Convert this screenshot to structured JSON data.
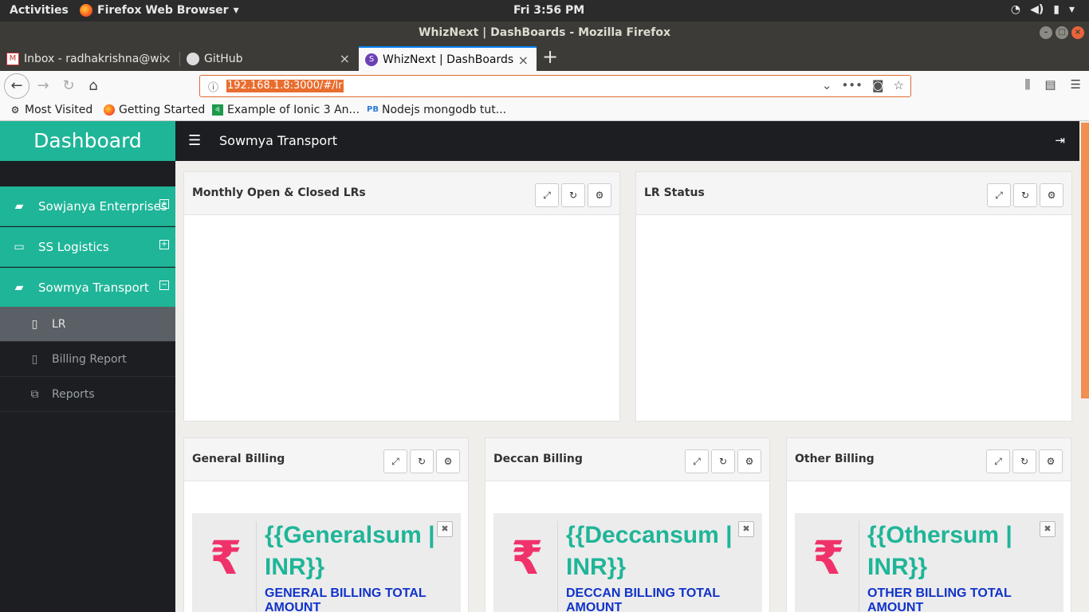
{
  "system": {
    "activities": "Activities",
    "app_menu": "Firefox Web Browser",
    "clock": "Fri  3:56 PM"
  },
  "window": {
    "title": "WhizNext | DashBoards - Mozilla Firefox"
  },
  "tabs": [
    {
      "label": "Inbox - radhakrishna@wi"
    },
    {
      "label": "GitHub"
    },
    {
      "label": "WhizNext | DashBoards"
    }
  ],
  "address_bar": {
    "url": "192.168.1.8:3000/#/lr"
  },
  "bookmarks": [
    {
      "label": "Most Visited"
    },
    {
      "label": "Getting Started"
    },
    {
      "label": "Example of Ionic 3 An..."
    },
    {
      "label": "Nodejs mongodb tut..."
    }
  ],
  "sidebar": {
    "brand": "Dashboard",
    "items": [
      {
        "label": "Sowjanya Enterprises"
      },
      {
        "label": "SS Logistics"
      },
      {
        "label": "Sowmya Transport"
      }
    ],
    "subitems": [
      {
        "label": "LR"
      },
      {
        "label": "Billing Report"
      },
      {
        "label": "Reports"
      }
    ]
  },
  "topbar": {
    "company": "Sowmya Transport"
  },
  "panels": {
    "monthly": {
      "title": "Monthly Open & Closed LRs"
    },
    "lr_status": {
      "title": "LR Status"
    },
    "general": {
      "title": "General Billing",
      "amount": "{{Generalsum | INR}}",
      "caption": "GENERAL BILLING TOTAL AMOUNT"
    },
    "deccan": {
      "title": "Deccan Billing",
      "amount": "{{Deccansum | INR}}",
      "caption": "DECCAN BILLING TOTAL AMOUNT"
    },
    "other": {
      "title": "Other Billing",
      "amount": "{{Othersum | INR}}",
      "caption": "OTHER BILLING TOTAL AMOUNT"
    }
  },
  "colors": {
    "accent": "#1fb598",
    "dark": "#1c1e22",
    "rupee": "#f0326b",
    "caption": "#1033c9"
  }
}
